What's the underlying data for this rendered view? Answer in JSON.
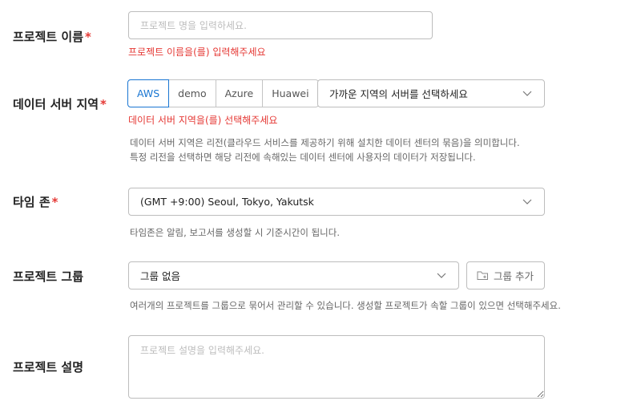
{
  "project_name": {
    "label": "프로젝트 이름",
    "required_mark": "*",
    "placeholder": "프로젝트 명을 입력하세요.",
    "value": "",
    "error": "프로젝트 이름을(를) 입력해주세요"
  },
  "data_region": {
    "label": "데이터 서버 지역",
    "required_mark": "*",
    "providers": [
      "AWS",
      "demo",
      "Azure",
      "Huawei"
    ],
    "selected_provider": "AWS",
    "region_select_value": "가까운 지역의 서버를 선택하세요",
    "error": "데이터 서버 지역을(를) 선택해주세요",
    "help_line1": "데이터 서버 지역은 리전(클라우드 서비스를 제공하기 위해 설치한 데이터 센터의 묶음)을 의미합니다.",
    "help_line2": "특정 리전을 선택하면 해당 리전에 속해있는 데이터 센터에 사용자의 데이터가 저장됩니다."
  },
  "timezone": {
    "label": "타임 존",
    "required_mark": "*",
    "select_value": "(GMT +9:00) Seoul, Tokyo, Yakutsk",
    "help": "타임존은 알림, 보고서를 생성할 시 기준시간이 됩니다."
  },
  "project_group": {
    "label": "프로젝트 그룹",
    "select_value": "그룹 없음",
    "add_button_label": "그룹 추가",
    "help": "여러개의 프로젝트를 그룹으로 묶어서 관리할 수 있습니다. 생성할 프로젝트가 속할 그룹이 있으면 선택해주세요."
  },
  "project_description": {
    "label": "프로젝트 설명",
    "placeholder": "프로젝트 설명을 입력해주세요.",
    "value": ""
  },
  "colors": {
    "required": "#e53935",
    "error": "#e53935",
    "accent": "#1976d2",
    "border": "#bdbdbd"
  },
  "icons": {
    "select_arrow": "chevron-down-icon",
    "add_group": "folder-plus-icon"
  }
}
